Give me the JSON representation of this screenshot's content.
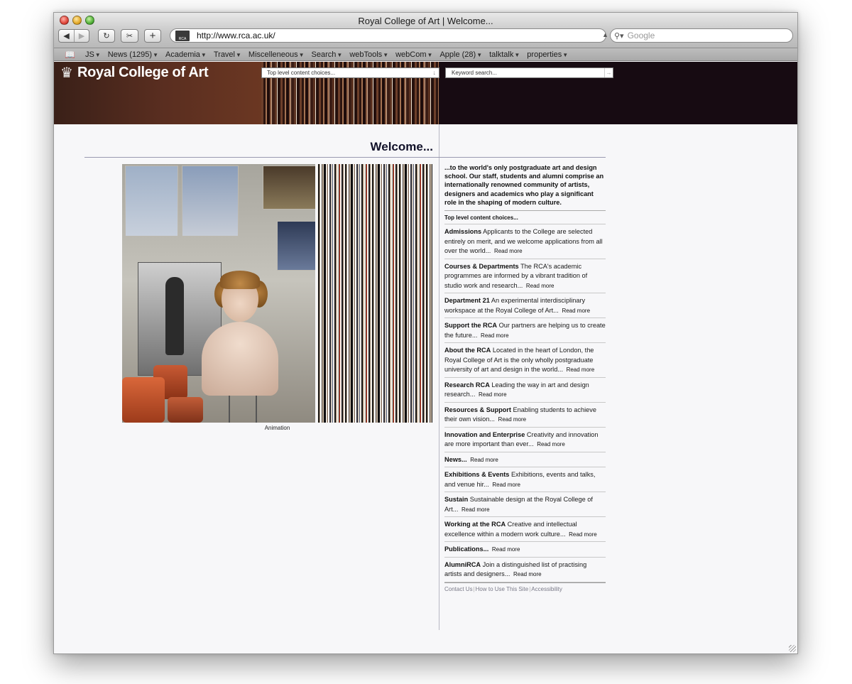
{
  "window": {
    "title": "Royal College of Art | Welcome..."
  },
  "toolbar": {
    "back_icon": "◀",
    "forward_icon": "▶",
    "reload_icon": "↻",
    "snap_icon": "✂",
    "add_icon": "+",
    "url": "http://www.rca.ac.uk/",
    "favicon_text": "RCA",
    "search_placeholder": "Google"
  },
  "bookmarks": [
    {
      "label": "JS"
    },
    {
      "label": "News (1295)"
    },
    {
      "label": "Academia"
    },
    {
      "label": "Travel"
    },
    {
      "label": "Miscelleneous"
    },
    {
      "label": "Search"
    },
    {
      "label": "webTools"
    },
    {
      "label": "webCom"
    },
    {
      "label": "Apple (28)"
    },
    {
      "label": "talktalk"
    },
    {
      "label": "properties"
    }
  ],
  "site": {
    "logo_text": "Royal College of Art",
    "top_select_placeholder": "Top level content choices...",
    "keyword_search_placeholder": "Keyword search...",
    "welcome_heading": "Welcome...",
    "image_caption": "Animation",
    "intro": "...to the world's only postgraduate art and design school. Our staff, students and alumni comprise an internationally renowned community of artists, designers and academics who play a significant role in the shaping of modern culture.",
    "choices_label": "Top level content choices...",
    "read_more": "Read more",
    "items": [
      {
        "title": "Admissions",
        "text": "Applicants to the College are selected entirely on merit, and we welcome applications from all over the world..."
      },
      {
        "title": "Courses & Departments",
        "text": "The RCA's academic programmes are informed by a vibrant tradition of studio work and research..."
      },
      {
        "title": "Department 21",
        "text": "An experimental interdisciplinary workspace at the Royal College of Art..."
      },
      {
        "title": "Support the RCA",
        "text": "Our partners are helping us to create the future..."
      },
      {
        "title": "About the RCA",
        "text": "Located in the heart of London, the Royal College of Art is the only wholly postgraduate university of art and design in the world..."
      },
      {
        "title": "Research RCA",
        "text": "Leading the way in art and design research..."
      },
      {
        "title": "Resources & Support",
        "text": "Enabling students to achieve their own vision..."
      },
      {
        "title": "Innovation and Enterprise",
        "text": "Creativity and innovation are more important than ever..."
      },
      {
        "title": "News...",
        "text": ""
      },
      {
        "title": "Exhibitions & Events",
        "text": "Exhibitions, events and talks, and venue hir..."
      },
      {
        "title": "Sustain",
        "text": "Sustainable design at the Royal College of Art..."
      },
      {
        "title": "Working at the RCA",
        "text": "Creative and intellectual excellence within a modern work culture..."
      },
      {
        "title": "Publications...",
        "text": ""
      },
      {
        "title": "AlumniRCA",
        "text": "Join a distinguished list of practising artists and designers..."
      }
    ],
    "footer": {
      "contact": "Contact Us",
      "how_to": "How to Use This Site",
      "accessibility": "Accessibility"
    }
  }
}
